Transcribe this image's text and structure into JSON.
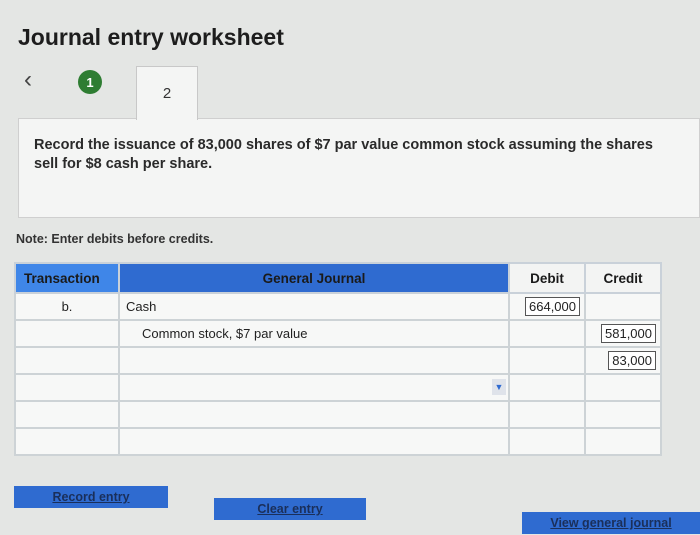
{
  "title": "Journal entry worksheet",
  "nav": {
    "step_one": "1",
    "step_two": "2"
  },
  "instruction": "Record the issuance of 83,000 shares of $7 par value common stock assuming the shares sell for $8 cash per share.",
  "note": "Note: Enter debits before credits.",
  "table": {
    "headers": {
      "transaction": "Transaction",
      "journal": "General Journal",
      "debit": "Debit",
      "credit": "Credit"
    },
    "rows": [
      {
        "transaction": "b.",
        "account": "Cash",
        "debit": "664,000",
        "credit": ""
      },
      {
        "transaction": "",
        "account": "Common stock, $7 par value",
        "debit": "",
        "credit": "581,000"
      },
      {
        "transaction": "",
        "account": "",
        "debit": "",
        "credit": "83,000"
      },
      {
        "transaction": "",
        "account": "",
        "debit": "",
        "credit": ""
      },
      {
        "transaction": "",
        "account": "",
        "debit": "",
        "credit": ""
      },
      {
        "transaction": "",
        "account": "",
        "debit": "",
        "credit": ""
      }
    ]
  },
  "buttons": {
    "record": "Record entry",
    "clear": "Clear entry",
    "view": "View general journal"
  },
  "colors": {
    "accent": "#2f6bd0",
    "step_done": "#2e7d32"
  }
}
